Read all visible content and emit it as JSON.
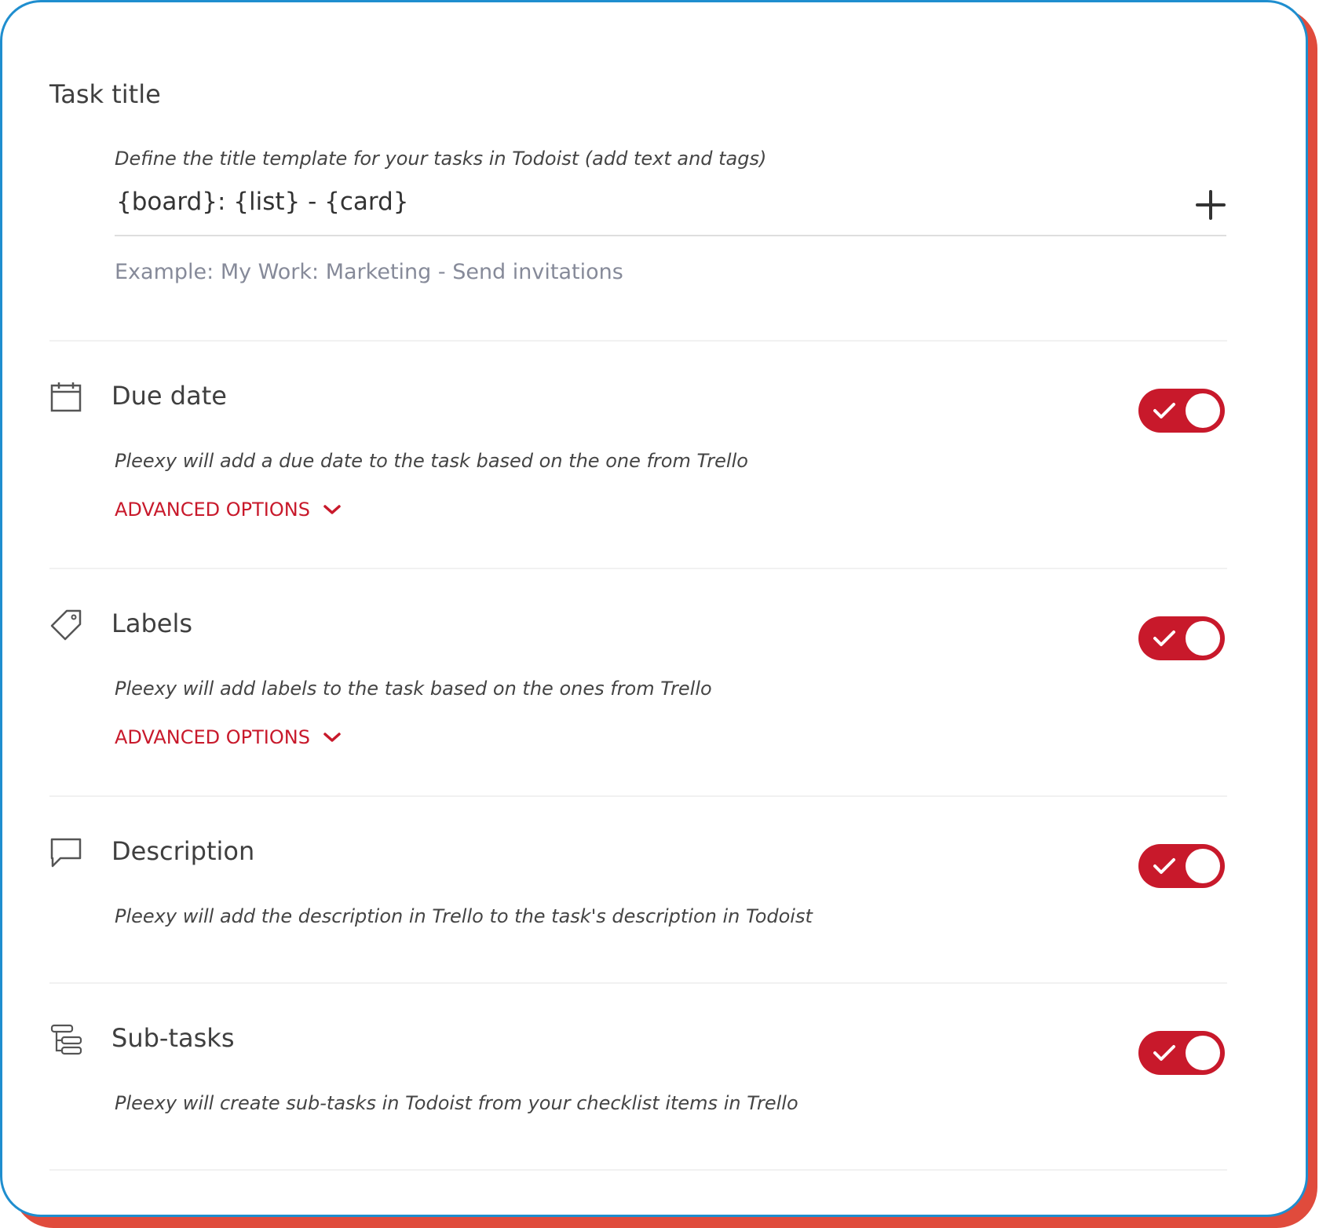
{
  "task_title": {
    "heading": "Task title",
    "hint": "Define the title template for your tasks in Todoist (add text and tags)",
    "template_value": "{board}: {list} - {card}",
    "example": "Example: My Work: Marketing - Send invitations",
    "add_icon": "plus-icon"
  },
  "sections": {
    "due_date": {
      "title": "Due date",
      "icon": "calendar-icon",
      "description": "Pleexy will add a due date to the task based on the one from Trello",
      "advanced_label": "ADVANCED OPTIONS",
      "enabled": true
    },
    "labels": {
      "title": "Labels",
      "icon": "tag-icon",
      "description": "Pleexy will add labels to the task based on the ones from Trello",
      "advanced_label": "ADVANCED OPTIONS",
      "enabled": true
    },
    "description": {
      "title": "Description",
      "icon": "speech-bubble-icon",
      "description": "Pleexy will add the description in Trello to the task's description in Todoist",
      "enabled": true
    },
    "subtasks": {
      "title": "Sub-tasks",
      "icon": "subtasks-icon",
      "description": "Pleexy will create sub-tasks in Todoist from your checklist items in Trello",
      "enabled": true
    }
  },
  "colors": {
    "accent": "#c8192b",
    "frame_border": "#1f8ecf",
    "frame_shadow": "#e04b3c",
    "example_text": "#868a99"
  }
}
